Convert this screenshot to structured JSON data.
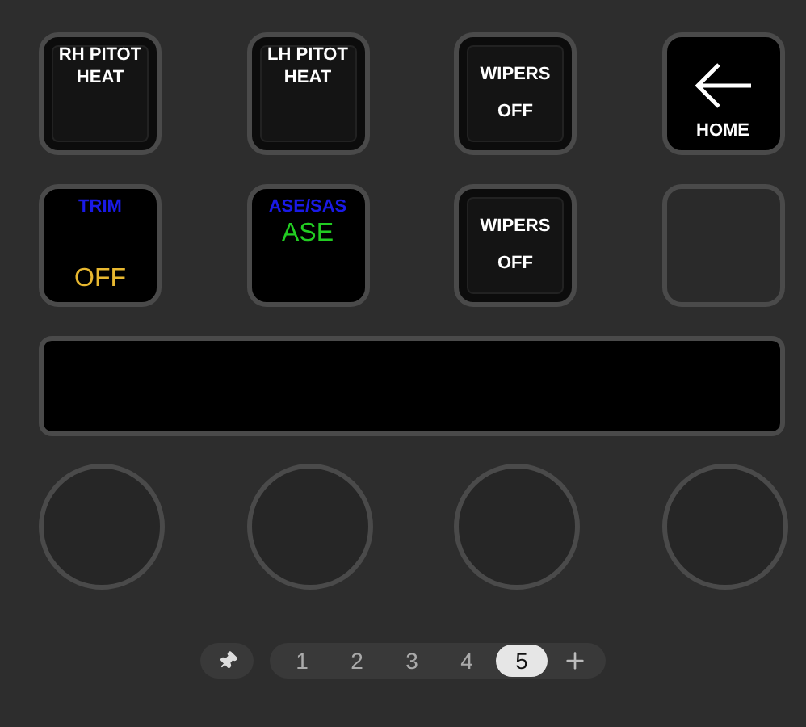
{
  "keys": [
    {
      "kind": "raised",
      "lines": [
        {
          "text": "RH PITOT",
          "color": "#ffffff"
        },
        {
          "text": "HEAT",
          "color": "#ffffff"
        }
      ]
    },
    {
      "kind": "raised",
      "lines": [
        {
          "text": "LH PITOT",
          "color": "#ffffff"
        },
        {
          "text": "HEAT",
          "color": "#ffffff"
        }
      ]
    },
    {
      "kind": "raised",
      "lines": [
        {
          "text": "WIPERS",
          "color": "#ffffff"
        },
        {
          "text": "OFF",
          "color": "#ffffff"
        }
      ]
    },
    {
      "kind": "home",
      "lines": [
        {
          "text": "HOME",
          "color": "#ffffff"
        }
      ]
    },
    {
      "kind": "flat",
      "lines": [
        {
          "text": "TRIM",
          "color": "#1a1ae6"
        },
        {
          "text": "OFF",
          "color": "#e8b830"
        }
      ]
    },
    {
      "kind": "flat",
      "lines": [
        {
          "text": "ASE/SAS",
          "color": "#1a1ae6"
        },
        {
          "text": "ASE",
          "color": "#22cc22"
        }
      ]
    },
    {
      "kind": "raised",
      "lines": [
        {
          "text": "WIPERS",
          "color": "#ffffff"
        },
        {
          "text": "OFF",
          "color": "#ffffff"
        }
      ]
    },
    {
      "kind": "empty"
    }
  ],
  "pages": [
    {
      "label": "1",
      "selected": false
    },
    {
      "label": "2",
      "selected": false
    },
    {
      "label": "3",
      "selected": false
    },
    {
      "label": "4",
      "selected": false
    },
    {
      "label": "5",
      "selected": true
    }
  ]
}
